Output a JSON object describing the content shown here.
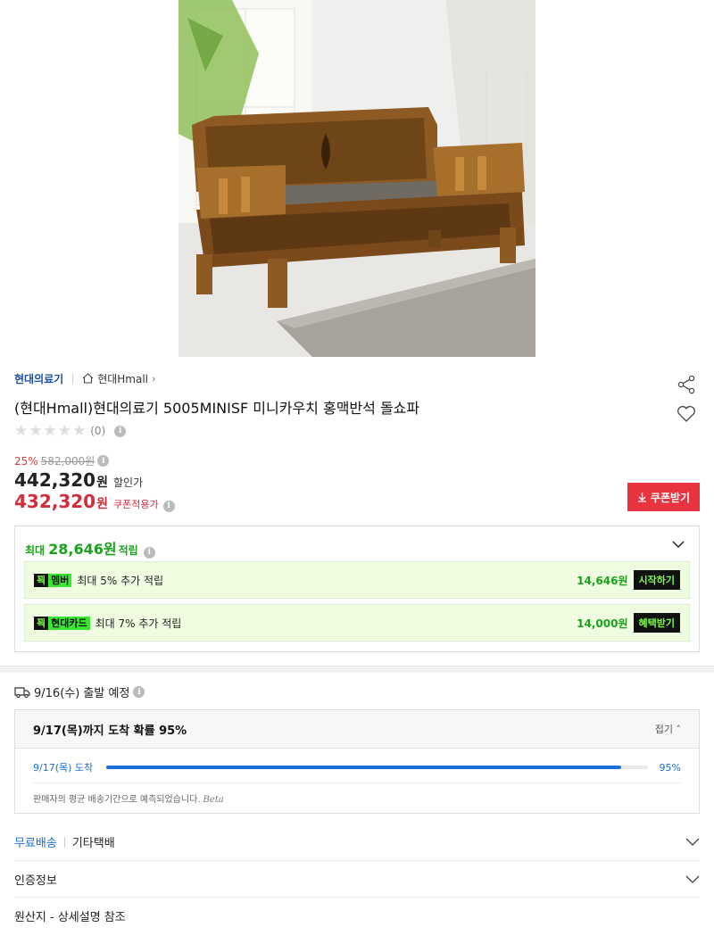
{
  "product": {
    "image_alt": "sofa-photo",
    "breadcrumb": {
      "brand": "현대의료기",
      "store": "현대Hmall"
    },
    "title": "(현대Hmall)현대의료기 5005MINISF 미니카우치 홍맥반석 돌쇼파",
    "rating": {
      "stars": 0,
      "count": "(0)"
    }
  },
  "price": {
    "discount_rate": "25%",
    "original": "582,000원",
    "sale": "442,320",
    "sale_unit": "원",
    "sale_tag": "할인가",
    "coupon": "432,320",
    "coupon_unit": "원",
    "coupon_tag": "쿠폰적용가",
    "coupon_button": "쿠폰받기"
  },
  "reward": {
    "prefix": "최대",
    "amount": "28,646원",
    "suffix": "적립",
    "rows": [
      {
        "badge_k": "꾁",
        "badge_n": "멤버",
        "desc": "최대 5% 추가 적립",
        "amount": "14,646원",
        "button": "시작하기"
      },
      {
        "badge_k": "꾁",
        "badge_n": "현대카드",
        "desc": "최대 7% 추가 적립",
        "amount": "14,000원",
        "button": "혜택받기"
      }
    ]
  },
  "shipping": {
    "depart": "9/16(수) 출발 예정",
    "eta_title": "9/17(목)까지 도착 확률 95%",
    "fold": "접기",
    "bar_label": "9/17(목) 도착",
    "bar_percent": "95%",
    "bar_value": 0.95,
    "note": "판매자의 평균 배송기간으로 예측되었습니다.",
    "note_beta": "Beta"
  },
  "rows": {
    "free_shipping": "무료배송",
    "carrier": "기타택배",
    "certification": "인증정보",
    "origin": "원산지 - 상세설명 참조"
  },
  "colors": {
    "accent_red": "#e8343f",
    "price_red": "#d22c3c",
    "green": "#1aa31a",
    "blue": "#1a6fd9"
  }
}
